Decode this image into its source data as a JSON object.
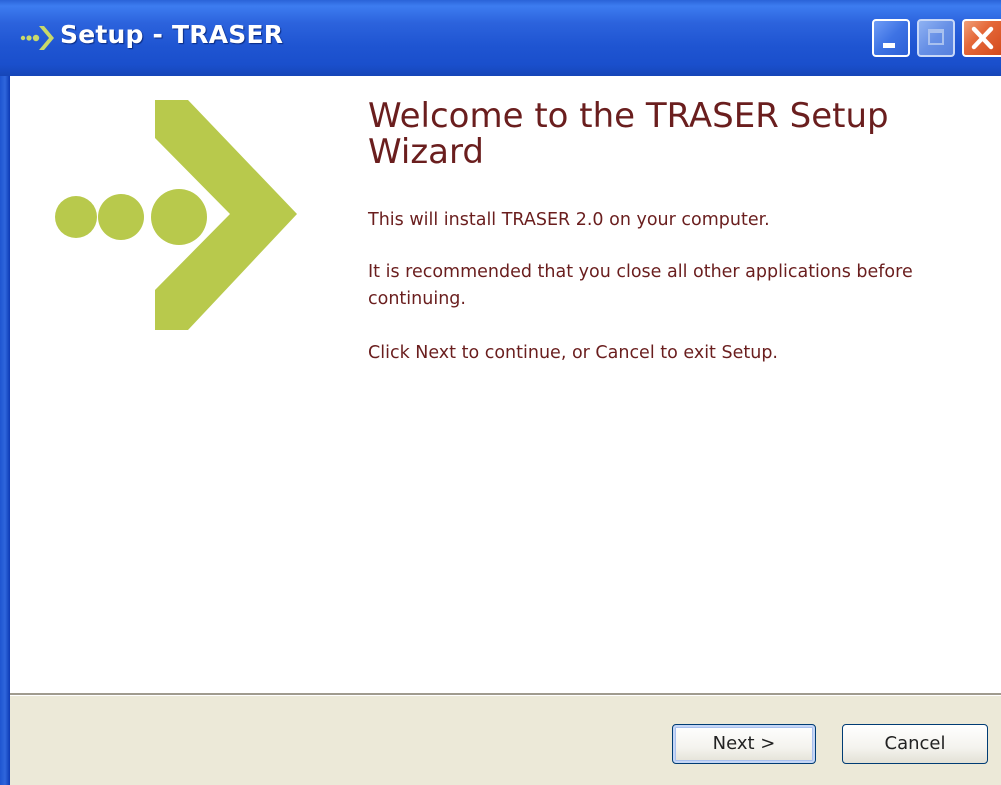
{
  "window": {
    "title": "Setup - TRASER",
    "controls": {
      "minimize": "minimize-icon",
      "maximize": "maximize-icon",
      "close": "close-icon"
    }
  },
  "main": {
    "heading": "Welcome to the TRASER Setup Wizard",
    "paragraphs": [
      "This will install TRASER 2.0 on your computer.",
      "It is recommended that you close all other applications before continuing.",
      "Click Next to continue, or Cancel to exit Setup."
    ],
    "logo_icon": "dots-arrow-icon"
  },
  "footer": {
    "next_label": "Next >",
    "cancel_label": "Cancel"
  },
  "colors": {
    "titlebar": "#1f55d2",
    "text": "#6a1e1e",
    "logo": "#b5c84a",
    "footer_bg": "#ece9d8"
  }
}
